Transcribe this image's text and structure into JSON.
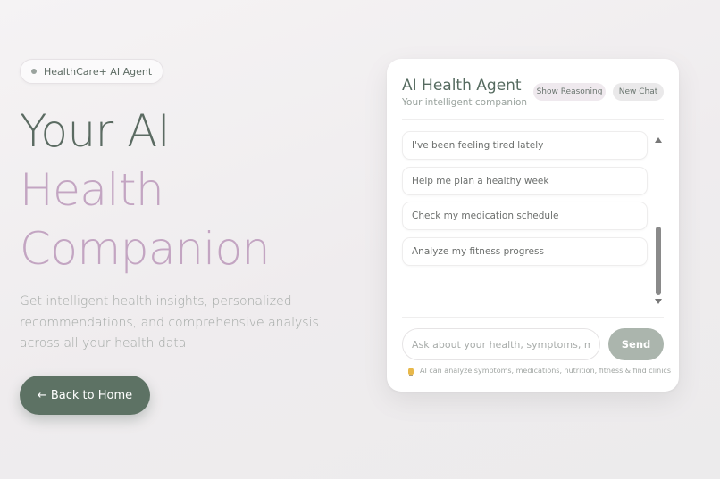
{
  "badge": {
    "label": "HealthCare+ AI Agent"
  },
  "hero": {
    "title_line_1": "Your AI",
    "title_line_2": "Health",
    "title_line_3": "Companion",
    "description": "Get intelligent health insights, personalized recommendations, and comprehensive analysis across all your health data.",
    "back_button_label": "← Back to Home"
  },
  "chat": {
    "title": "AI Health Agent",
    "subtitle": "Your intelligent companion",
    "show_reasoning_label": "Show Reasoning",
    "new_chat_label": "New Chat",
    "suggestions": [
      {
        "label": "I've been feeling tired lately"
      },
      {
        "label": "Help me plan a healthy week"
      },
      {
        "label": "Check my medication schedule"
      },
      {
        "label": "Analyze my fitness progress"
      }
    ],
    "input_placeholder": "Ask about your health, symptoms, medications...",
    "send_label": "Send",
    "hint": "AI can analyze symptoms, medications, nutrition, fitness & find clinics"
  },
  "colors": {
    "accent_green": "#5d7264",
    "accent_mauve": "#c3a5c2",
    "send_disabled": "#abb5ad"
  },
  "icons": {
    "badge_dot": "status-dot-icon",
    "hint": "lightbulb-icon"
  }
}
